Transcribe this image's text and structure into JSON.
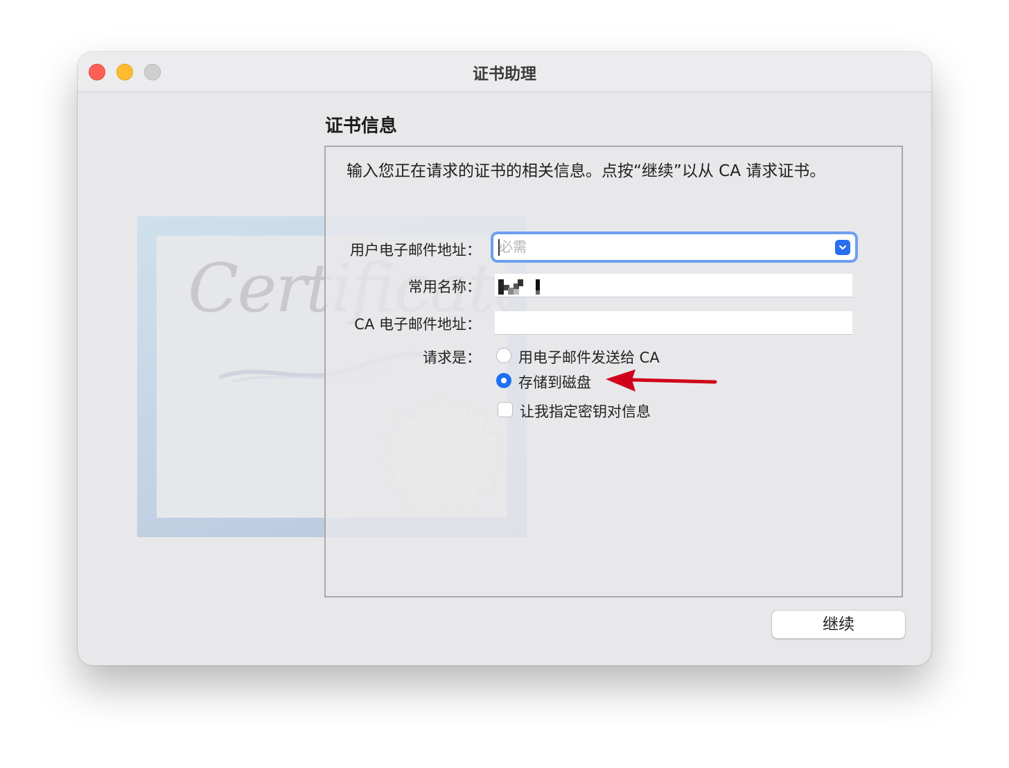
{
  "window": {
    "title": "证书助理"
  },
  "section_title": "证书信息",
  "intro_text": "输入您正在请求的证书的相关信息。点按“继续”以从 CA 请求证书。",
  "background_art": {
    "word": "Certificate"
  },
  "form": {
    "email_label": "用户电子邮件地址：",
    "email_placeholder": "必需",
    "email_value": "",
    "name_label": "常用名称：",
    "name_value": "",
    "ca_email_label": "CA 电子邮件地址：",
    "ca_email_value": "",
    "request_label": "请求是：",
    "options": [
      {
        "label": "用电子邮件发送给 CA",
        "selected": false
      },
      {
        "label": "存储到磁盘",
        "selected": true
      }
    ],
    "key_pair_checkbox": {
      "label": "让我指定密钥对信息",
      "checked": false
    }
  },
  "buttons": {
    "continue": "继续"
  },
  "colors": {
    "accent": "#1f6ff5",
    "arrow": "#d0021b",
    "focus_ring": "#6e9ff0"
  },
  "icons": {
    "dropdown": "chevron-down-icon",
    "annotation": "red-arrow-icon"
  }
}
